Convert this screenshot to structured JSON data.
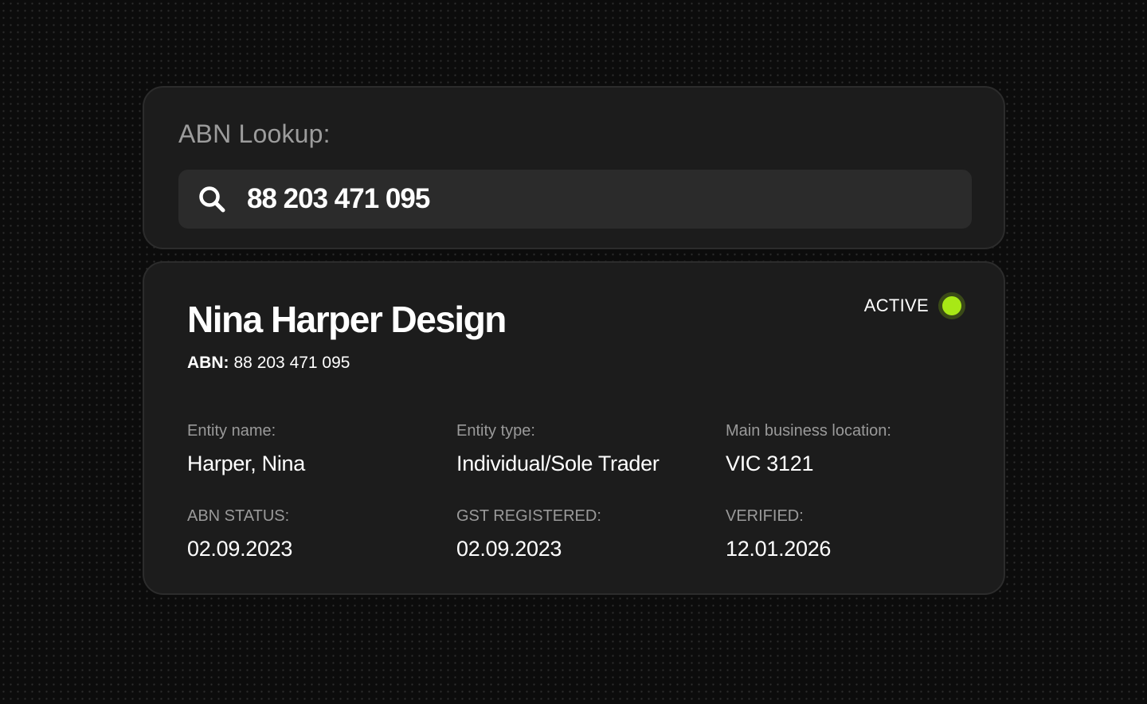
{
  "lookup": {
    "title": "ABN Lookup:",
    "search_value": "88 203 471 095"
  },
  "result": {
    "business_name": "Nina Harper Design",
    "abn_label": "ABN:",
    "abn_value": "88 203 471 095",
    "status": {
      "label": "ACTIVE",
      "color": "#a8e816"
    },
    "fields": [
      {
        "label": "Entity name:",
        "value": "Harper, Nina"
      },
      {
        "label": "Entity type:",
        "value": "Individual/Sole Trader"
      },
      {
        "label": "Main business location:",
        "value": "VIC 3121"
      },
      {
        "label": "ABN STATUS:",
        "value": "02.09.2023"
      },
      {
        "label": "GST REGISTERED:",
        "value": "02.09.2023"
      },
      {
        "label": "VERIFIED:",
        "value": "12.01.2026"
      }
    ]
  },
  "icons": {
    "search": "search-icon"
  }
}
